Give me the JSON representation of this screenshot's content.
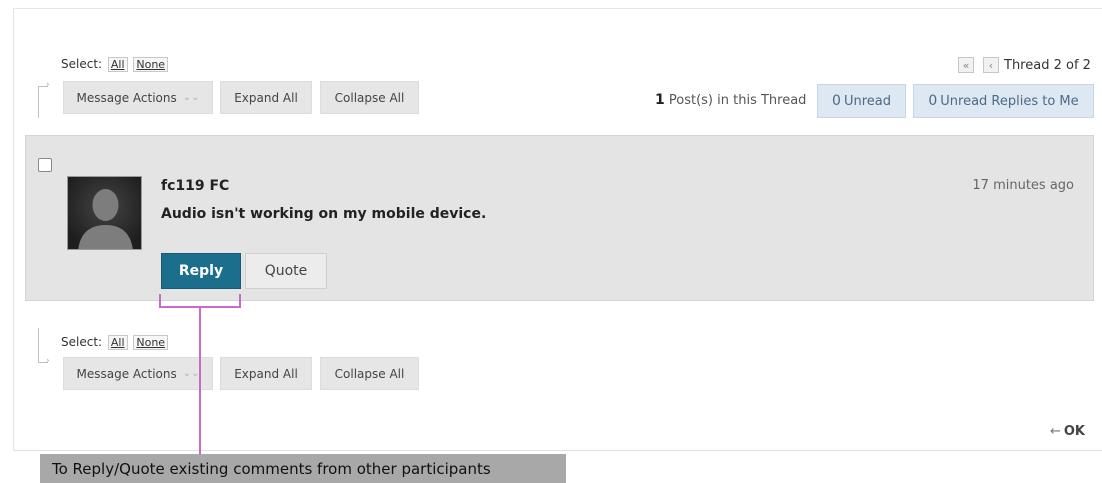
{
  "top_toolbar": {
    "select_label": "Select:",
    "select_all": "All",
    "select_none": "None",
    "message_actions": "Message Actions",
    "expand_all": "Expand All",
    "collapse_all": "Collapse All"
  },
  "thread_nav": {
    "thread_label": "Thread 2 of 2",
    "first_glyph": "«",
    "prev_glyph": "‹"
  },
  "thread_stats": {
    "post_count": "1",
    "post_count_label": "Post(s) in this Thread",
    "unread_count": "0",
    "unread_label": "Unread",
    "unread_replies_count": "0",
    "unread_replies_label": "Unread Replies to Me"
  },
  "post": {
    "author": "fc119 FC",
    "message": "Audio isn't working on my mobile device.",
    "timestamp": "17 minutes ago",
    "reply_label": "Reply",
    "quote_label": "Quote"
  },
  "bottom_toolbar": {
    "select_label": "Select:",
    "select_all": "All",
    "select_none": "None",
    "message_actions": "Message Actions",
    "expand_all": "Expand All",
    "collapse_all": "Collapse All"
  },
  "ok_link": {
    "arrow": "←",
    "label": "OK"
  },
  "annotation": {
    "caption": "To Reply/Quote existing comments from other participants",
    "color": "#c86bc8"
  },
  "colors": {
    "reply_button": "#1b6e8c",
    "unread_button": "#dde8f2",
    "post_background": "#e4e4e4"
  }
}
